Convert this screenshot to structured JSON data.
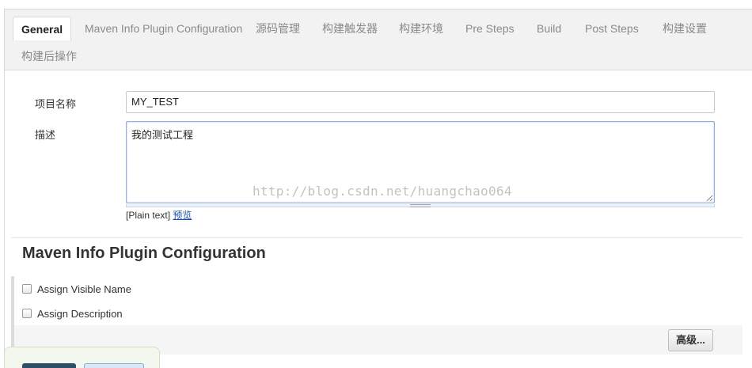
{
  "tabs": [
    {
      "label": "General",
      "active": true
    },
    {
      "label": "Maven Info Plugin Configuration",
      "active": false
    },
    {
      "label": "源码管理",
      "active": false
    },
    {
      "label": "构建触发器",
      "active": false
    },
    {
      "label": "构建环境",
      "active": false
    },
    {
      "label": "Pre Steps",
      "active": false
    },
    {
      "label": "Build",
      "active": false
    },
    {
      "label": "Post Steps",
      "active": false
    },
    {
      "label": "构建设置",
      "active": false
    },
    {
      "label": "构建后操作",
      "active": false
    }
  ],
  "general": {
    "project_name_label": "项目名称",
    "project_name_value": "MY_TEST",
    "description_label": "描述",
    "description_value": "我的测试工程",
    "format_text": "[Plain text]",
    "preview_link": "预览"
  },
  "watermark": "http://blog.csdn.net/huangchao064",
  "maven_section": {
    "title": "Maven Info Plugin Configuration",
    "checkboxes": [
      {
        "label": "Assign Visible Name",
        "checked": false
      },
      {
        "label": "Assign Description",
        "checked": false
      }
    ],
    "advanced_button": "高级..."
  },
  "colors": {
    "tab_bar_bg": "#f2f2f2",
    "link": "#1a4e9e",
    "save_button": "#2e4e68",
    "apply_button": "#dbe7f6"
  }
}
